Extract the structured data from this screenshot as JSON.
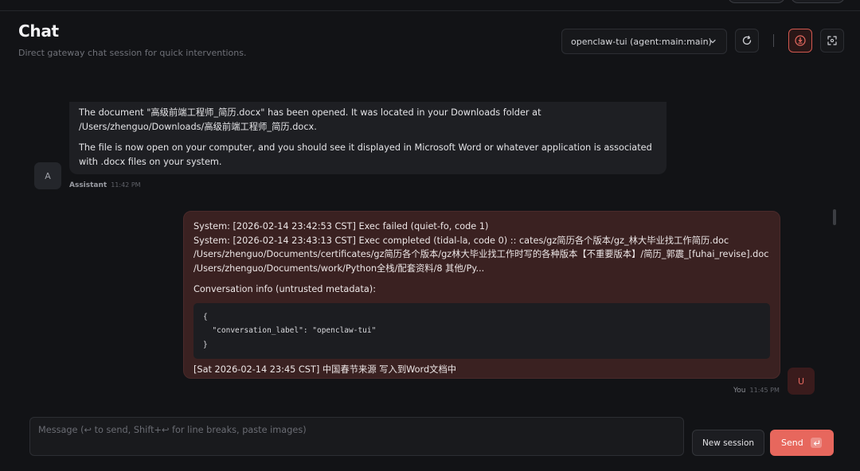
{
  "header": {
    "title": "Chat",
    "subtitle": "Direct gateway chat session for quick interventions.",
    "session_select": "openclaw-tui (agent:main:main)",
    "icons": [
      "refresh-icon",
      "focus-icon",
      "fullscreen-icon"
    ],
    "colors": {
      "accent": "#e7675d"
    }
  },
  "messages": {
    "assistant": {
      "avatar": "A",
      "name": "Assistant",
      "time": "11:42 PM",
      "para1": "The document \"高级前端工程师_简历.docx\" has been opened. It was located in your Downloads folder at /Users/zhenguo/Downloads/高级前端工程师_简历.docx.",
      "para2": "The file is now open on your computer, and you should see it displayed in Microsoft Word or whatever application is associated with .docx files on your system."
    },
    "user": {
      "avatar": "U",
      "name": "You",
      "time": "11:45 PM",
      "system1": "System: [2026-02-14 23:42:53 CST] Exec failed (quiet-fo, code 1)",
      "system2": "System: [2026-02-14 23:43:13 CST] Exec completed (tidal-la, code 0) :: cates/gz简历各个版本/gz_林大毕业找工作简历.doc /Users/zhenguo/Documents/certificates/gz简历各个版本/gz林大毕业找工作时写的各种版本【不重要版本】/简历_郭震_[fuhai_revise].doc /Users/zhenguo/Documents/work/Python全栈/配套资料/8 其他/Py...",
      "info_label": "Conversation info (untrusted metadata):",
      "code": "{\n  \"conversation_label\": \"openclaw-tui\"\n}",
      "final": "[Sat 2026-02-14 23:45 CST] 中国春节来源 写入到Word文档中"
    }
  },
  "composer": {
    "placeholder": "Message (↩ to send, Shift+↩ for line breaks, paste images)",
    "new_session_label": "New session",
    "send_label": "Send",
    "send_kbd": "↩"
  }
}
